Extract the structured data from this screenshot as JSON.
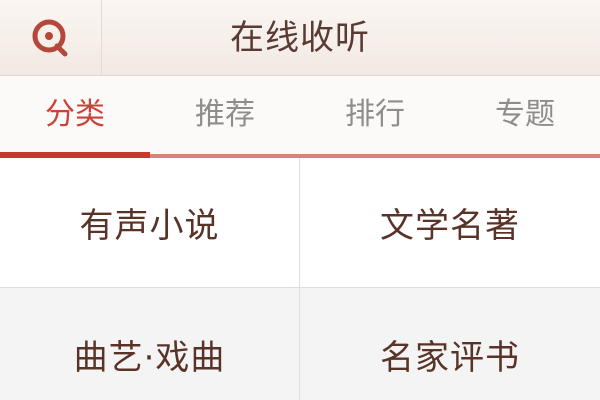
{
  "header": {
    "title": "在线收听",
    "search_icon": "search-icon"
  },
  "tabs": [
    {
      "label": "分类",
      "active": true
    },
    {
      "label": "推荐",
      "active": false
    },
    {
      "label": "排行",
      "active": false
    },
    {
      "label": "专题",
      "active": false
    }
  ],
  "categories": [
    {
      "label": "有声小说"
    },
    {
      "label": "文学名著"
    },
    {
      "label": "曲艺·戏曲"
    },
    {
      "label": "名家评书"
    }
  ],
  "colors": {
    "accent": "#c6392f",
    "title_text": "#5a3b34",
    "tab_inactive": "#8f8c8b"
  }
}
